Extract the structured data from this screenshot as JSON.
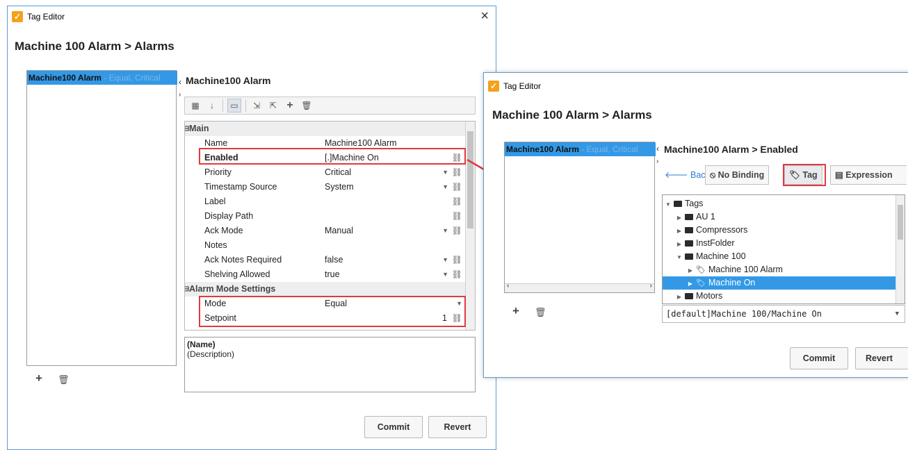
{
  "win1": {
    "title": "Tag Editor",
    "close": "×",
    "heading": "Machine 100 Alarm > Alarms",
    "list_item": {
      "name": "Machine100 Alarm",
      "sub": " - Equal, Critical"
    },
    "panel_title": "Machine100 Alarm",
    "sections": [
      {
        "title": "Main"
      },
      {
        "title": "Alarm Mode Settings"
      }
    ],
    "rows": [
      {
        "key": "Name",
        "value": "Machine100 Alarm"
      },
      {
        "key": "Enabled",
        "value": "[.]Machine On"
      },
      {
        "key": "Priority",
        "value": "Critical"
      },
      {
        "key": "Timestamp Source",
        "value": "System"
      },
      {
        "key": "Label",
        "value": ""
      },
      {
        "key": "Display Path",
        "value": ""
      },
      {
        "key": "Ack Mode",
        "value": "Manual"
      },
      {
        "key": "Notes",
        "value": ""
      },
      {
        "key": "Ack Notes Required",
        "value": "false"
      },
      {
        "key": "Shelving Allowed",
        "value": "true"
      },
      {
        "key": "Mode",
        "value": "Equal"
      },
      {
        "key": "Setpoint",
        "value": "1"
      }
    ],
    "desc": {
      "name": "(Name)",
      "description": "(Description)"
    },
    "commit": "Commit",
    "revert": "Revert"
  },
  "win2": {
    "title": "Tag Editor",
    "heading": "Machine 100 Alarm > Alarms",
    "list_item": {
      "name": "Machine100 Alarm",
      "sub": " - Equal, Critical"
    },
    "panel_title": "Machine100 Alarm > Enabled",
    "back": "Back",
    "no_binding": "No Binding",
    "tag": "Tag",
    "expression": "Expression",
    "tree": [
      {
        "label": "Tags"
      },
      {
        "label": "AU 1"
      },
      {
        "label": "Compressors"
      },
      {
        "label": "InstFolder"
      },
      {
        "label": "Machine 100"
      },
      {
        "label": "Machine 100 Alarm"
      },
      {
        "label": "Machine On"
      },
      {
        "label": "Motors"
      }
    ],
    "path": "[default]Machine 100/Machine On",
    "commit": "Commit",
    "revert": "Revert"
  },
  "colors": {
    "accent": "#3399e6",
    "highlight": "#e0393e",
    "window_border": "#5b9bd5"
  }
}
